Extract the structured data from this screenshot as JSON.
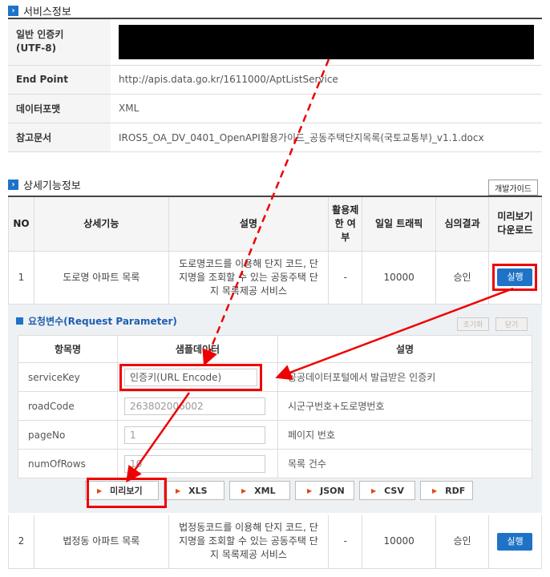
{
  "service_info": {
    "title": "서비스정보",
    "rows": [
      {
        "key": "일반 인증키\n(UTF-8)",
        "value": ""
      },
      {
        "key": "End Point",
        "value": "http://apis.data.go.kr/1611000/AptListService"
      },
      {
        "key": "데이터포맷",
        "value": "XML"
      },
      {
        "key": "참고문서",
        "value": "IROS5_OA_DV_0401_OpenAPI활용가이드_공동주택단지목록(국토교통부)_v1.1.docx"
      }
    ]
  },
  "detail_info": {
    "title": "상세기능정보",
    "guide_button": "개발가이드",
    "headers": {
      "no": "NO",
      "func": "상세기능",
      "desc": "설명",
      "limit": "활용제\n한 여\n부",
      "traffic": "일일 트래픽",
      "review": "심의결과",
      "preview": "미리보기\n다운로드"
    },
    "rows": [
      {
        "no": "1",
        "func": "도로명 아파트 목록",
        "desc": "도로명코드를 이용해 단지 코드, 단\n지명을 조회할 수 있는 공동주택 단\n지 목록제공 서비스",
        "limit": "-",
        "traffic": "10000",
        "review": "승인",
        "btn": "실행"
      },
      {
        "no": "2",
        "func": "법정동 아파트 목록",
        "desc": "법정동코드를 이용해 단지 코드, 단\n지명을 조회할 수 있는 공동주택 단\n지 목록제공 서비스",
        "limit": "-",
        "traffic": "10000",
        "review": "승인",
        "btn": "실행"
      }
    ]
  },
  "request": {
    "title": "요청변수(Request Parameter)",
    "reset": "초기화",
    "close": "닫기",
    "headers": {
      "name": "항목명",
      "sample": "샘플데이터",
      "desc": "설명"
    },
    "params": [
      {
        "name": "serviceKey",
        "sample": "인증키(URL Encode)",
        "desc": "공공데이터포털에서 발급받은 인증키"
      },
      {
        "name": "roadCode",
        "sample": "263802006002",
        "desc": "시군구번호+도로명번호"
      },
      {
        "name": "pageNo",
        "sample": "1",
        "desc": "페이지 번호"
      },
      {
        "name": "numOfRows",
        "sample": "10",
        "desc": "목록 건수"
      }
    ],
    "formats": [
      "미리보기",
      "XLS",
      "XML",
      "JSON",
      "CSV",
      "RDF"
    ]
  },
  "colors": {
    "accent": "#1e73c7",
    "highlight": "#e00000"
  }
}
